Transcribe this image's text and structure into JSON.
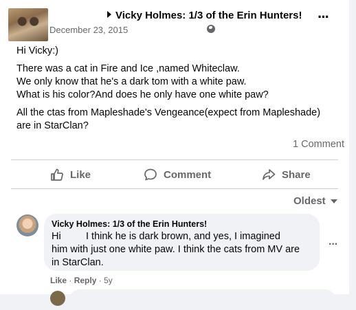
{
  "post": {
    "author": "Vicky Holmes: 1/3 of the Erin Hunters!",
    "date": "December 23, 2015",
    "lines": [
      "Hi Vicky:)",
      "There was a cat in Fire and Ice ,named Whiteclaw.",
      "We only know that he's a dark tom with a white paw.",
      "What is his color?And does he only have one white paw?",
      "All the ctas from Mapleshade's Vengeance(expect from Mapleshade)",
      "are in StarClan?"
    ],
    "comment_count": "1 Comment"
  },
  "actions": {
    "like": "Like",
    "comment": "Comment",
    "share": "Share"
  },
  "sort": {
    "label": "Oldest"
  },
  "comment": {
    "author": "Vicky Holmes: 1/3 of the Erin Hunters!",
    "lines": [
      "Hi",
      "I think he is dark brown, and yes, I imagined",
      "him with just one white paw. I think the cats from MV are",
      "in StarClan."
    ],
    "like_label": "Like",
    "reply_label": "Reply",
    "age": "5y"
  },
  "icons": {
    "more": "more-horizontal-icon",
    "privacy": "globe-icon",
    "like": "thumbs-up-icon",
    "comment": "speech-bubble-icon",
    "share": "share-arrow-icon",
    "sort": "caret-down-icon"
  },
  "colors": {
    "text": "#050505",
    "secondary": "#65676b",
    "bubble": "#f0f2f5",
    "divider": "#ced0d4"
  }
}
